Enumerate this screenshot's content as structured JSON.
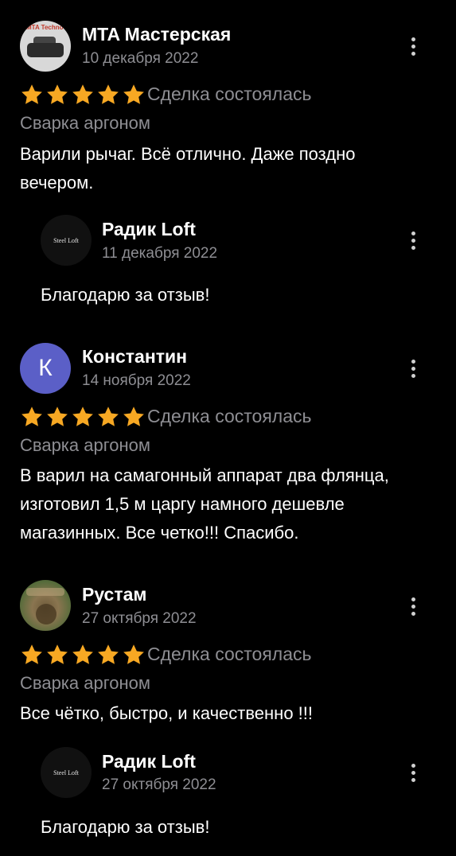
{
  "colors": {
    "background": "#000000",
    "star": "#f7a823",
    "secondary_text": "#8e8e93",
    "avatar_letter_bg": "#5b5fc7"
  },
  "reviews": [
    {
      "author": "MTA Мастерская",
      "date": "10 декабря 2022",
      "avatar_text": "MTA Techno",
      "rating": 5,
      "deal_status": "Сделка состоялась",
      "service": "Сварка аргоном",
      "text": "Варили рычаг. Всё отлично. Даже поздно вечером.",
      "reply": {
        "author": "Радик Loft",
        "date": "11 декабря 2022",
        "avatar_text": "Steel Loft",
        "text": "Благодарю за отзыв!"
      }
    },
    {
      "author": "Константин",
      "date": "14 ноября 2022",
      "avatar_letter": "К",
      "rating": 5,
      "deal_status": "Сделка состоялась",
      "service": "Сварка аргоном",
      "text": "В варил на самагонный аппарат два флянца, изготовил 1,5 м царгу намного дешевле магазинных. Все четко!!! Спасибо."
    },
    {
      "author": "Рустам",
      "date": "27 октября 2022",
      "rating": 5,
      "deal_status": "Сделка состоялась",
      "service": "Сварка аргоном",
      "text": "Все чётко, быстро, и качественно !!!",
      "reply": {
        "author": "Радик Loft",
        "date": "27 октября 2022",
        "avatar_text": "Steel Loft",
        "text": "Благодарю за отзыв!"
      }
    }
  ],
  "icons": {
    "star": "star-icon",
    "menu": "more-vertical-icon"
  }
}
